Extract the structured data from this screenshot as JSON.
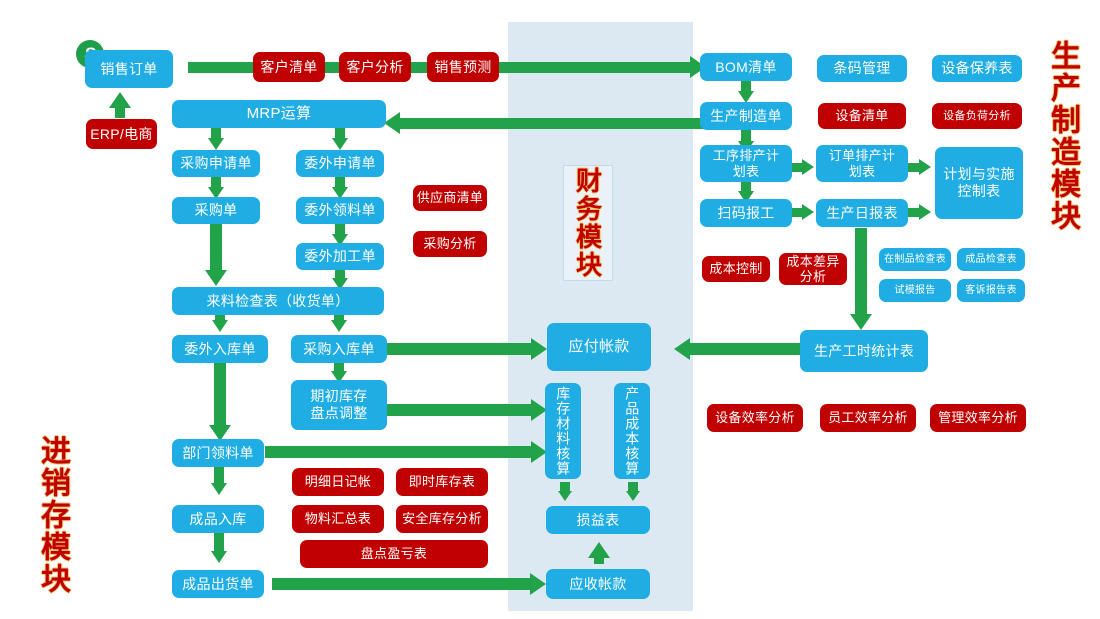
{
  "modules": {
    "inventory_label": "进销存模块",
    "production_label": "生产制造模块",
    "finance_label": "财务模块"
  },
  "start_marker": "S",
  "nodes": {
    "sales_order": "销售订单",
    "erp_ecommerce": "ERP/电商",
    "customer_list": "客户清单",
    "customer_analysis": "客户分析",
    "sales_forecast": "销售预测",
    "mrp": "MRP运算",
    "purchase_request": "采购申请单",
    "outsource_request": "委外申请单",
    "purchase_order": "采购单",
    "outsource_picking": "委外领料单",
    "outsource_processing": "委外加工单",
    "supplier_list": "供应商清单",
    "purchase_analysis": "采购分析",
    "incoming_inspection": "来料检查表（收货单）",
    "outsource_receipt": "委外入库单",
    "purchase_receipt": "采购入库单",
    "opening_stock_adjust": "期初库存\n盘点调整",
    "dept_picking": "部门领料单",
    "detail_journal": "明细日记帐",
    "realtime_stock": "即时库存表",
    "material_summary": "物料汇总表",
    "safety_stock_analysis": "安全库存分析",
    "stocktake_pl": "盘点盈亏表",
    "fg_receipt": "成品入库",
    "fg_shipment": "成品出货单",
    "accounts_payable": "应付帐款",
    "inventory_material_accounting": "库存材料核算",
    "product_cost_accounting": "产品成本核算",
    "income_statement": "损益表",
    "accounts_receivable": "应收帐款",
    "bom_list": "BOM清单",
    "barcode_management": "条码管理",
    "equipment_maintenance": "设备保养表",
    "production_order": "生产制造单",
    "equipment_list": "设备清单",
    "equipment_load_analysis": "设备负荷分析",
    "process_schedule": "工序排产计\n划表",
    "order_schedule": "订单排产计\n划表",
    "plan_execution_control": "计划与实施\n控制表",
    "scan_report": "扫码报工",
    "production_daily_report": "生产日报表",
    "cost_control": "成本控制",
    "cost_variance_analysis": "成本差异\n分析",
    "wip_inspection": "在制品检查表",
    "fg_inspection": "成品检查表",
    "trial_mold_report": "试模报告",
    "complaint_report": "客诉报告表",
    "production_hours_stat": "生产工时统计表",
    "equipment_efficiency": "设备效率分析",
    "staff_efficiency": "员工效率分析",
    "management_efficiency": "管理效率分析"
  },
  "colors": {
    "blue": "#1fade4",
    "red": "#c00000",
    "green": "#22a34a",
    "band": "#dce9f3",
    "module_title": "#c00000"
  }
}
